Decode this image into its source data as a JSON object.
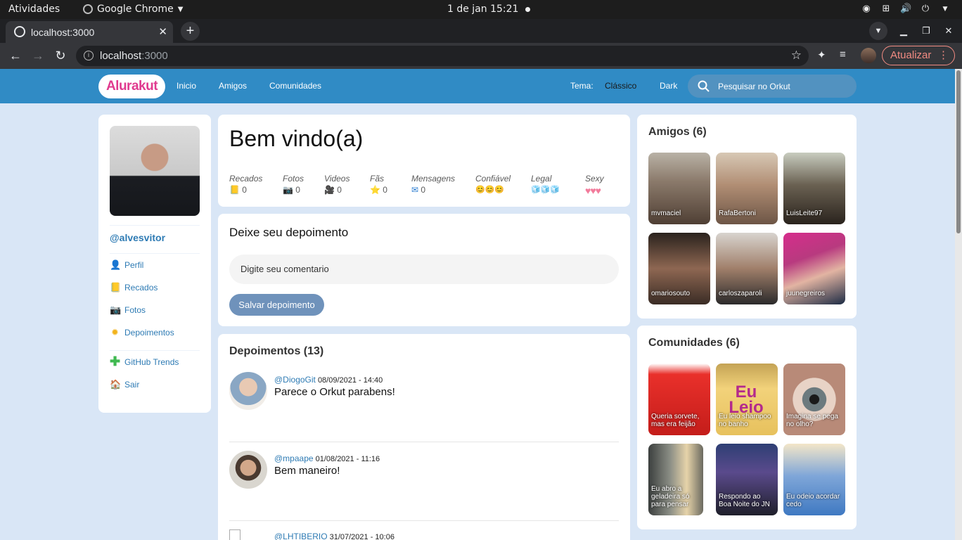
{
  "system": {
    "activities": "Atividades",
    "app_name": "Google Chrome",
    "clock": "1 de jan  15:21"
  },
  "browser": {
    "tab_title": "localhost:3000",
    "url_host": "localhost",
    "url_port": ":3000",
    "update_label": "Atualizar"
  },
  "header": {
    "logo": "Alurakut",
    "nav": [
      "Inicio",
      "Amigos",
      "Comunidades"
    ],
    "theme_label": "Tema:",
    "theme_options": [
      "Clássico",
      "Dark"
    ],
    "search_placeholder": "Pesquisar no Orkut",
    "colors": {
      "bar": "#308BC5",
      "logo": "#E03A8F"
    }
  },
  "profile": {
    "handle": "@alvesvitor",
    "menu": [
      {
        "label": "Perfil",
        "icon": "user-icon"
      },
      {
        "label": "Recados",
        "icon": "book-icon"
      },
      {
        "label": "Fotos",
        "icon": "camera-icon"
      },
      {
        "label": "Depoimentos",
        "icon": "sun-icon"
      }
    ],
    "menu2": [
      {
        "label": "GitHub Trends",
        "icon": "plus-icon"
      },
      {
        "label": "Sair",
        "icon": "house-icon"
      }
    ]
  },
  "welcome": {
    "title": "Bem vindo(a)",
    "stats": [
      {
        "label": "Recados",
        "icon": "📒",
        "value": "0"
      },
      {
        "label": "Fotos",
        "icon": "📷",
        "value": "0"
      },
      {
        "label": "Videos",
        "icon": "🎥",
        "value": "0"
      },
      {
        "label": "Fãs",
        "icon": "⭐",
        "value": "0"
      },
      {
        "label": "Mensagens",
        "icon": "✉",
        "value": "0"
      },
      {
        "label": "Confiável",
        "icon": "😊😊😊",
        "value": ""
      },
      {
        "label": "Legal",
        "icon": "🧊🧊🧊",
        "value": ""
      },
      {
        "label": "Sexy",
        "icon": "♥♥♥",
        "value": ""
      }
    ]
  },
  "testimonial_form": {
    "title": "Deixe seu depoimento",
    "placeholder": "Digite seu comentario",
    "button": "Salvar depoimento"
  },
  "testimonials": {
    "title": "Depoimentos (13)",
    "items": [
      {
        "user": "@DiogoGit",
        "date": "08/09/2021 - 14:40",
        "message": "Parece o Orkut parabens!"
      },
      {
        "user": "@mpaape",
        "date": "01/08/2021 - 11:16",
        "message": "Bem maneiro!"
      },
      {
        "user": "@LHTIBERIO",
        "date": "31/07/2021 - 10:06",
        "message": ""
      }
    ]
  },
  "friends": {
    "title": "Amigos (6)",
    "items": [
      "mvmaciel",
      "RafaBertoni",
      "LuisLeite97",
      "omariosouto",
      "carloszaparoli",
      "juunegreiros"
    ]
  },
  "communities": {
    "title": "Comunidades (6)",
    "items": [
      "Queria sorvete, mas era feijão",
      "Eu leio shampoo no banho",
      "Imagina se pega no olho?",
      "Eu abro a geladeira só para pensar",
      "Respondo ao Boa Noite do JN",
      "Eu odeio acordar cedo"
    ],
    "shampoo_text": "Eu Leio"
  }
}
